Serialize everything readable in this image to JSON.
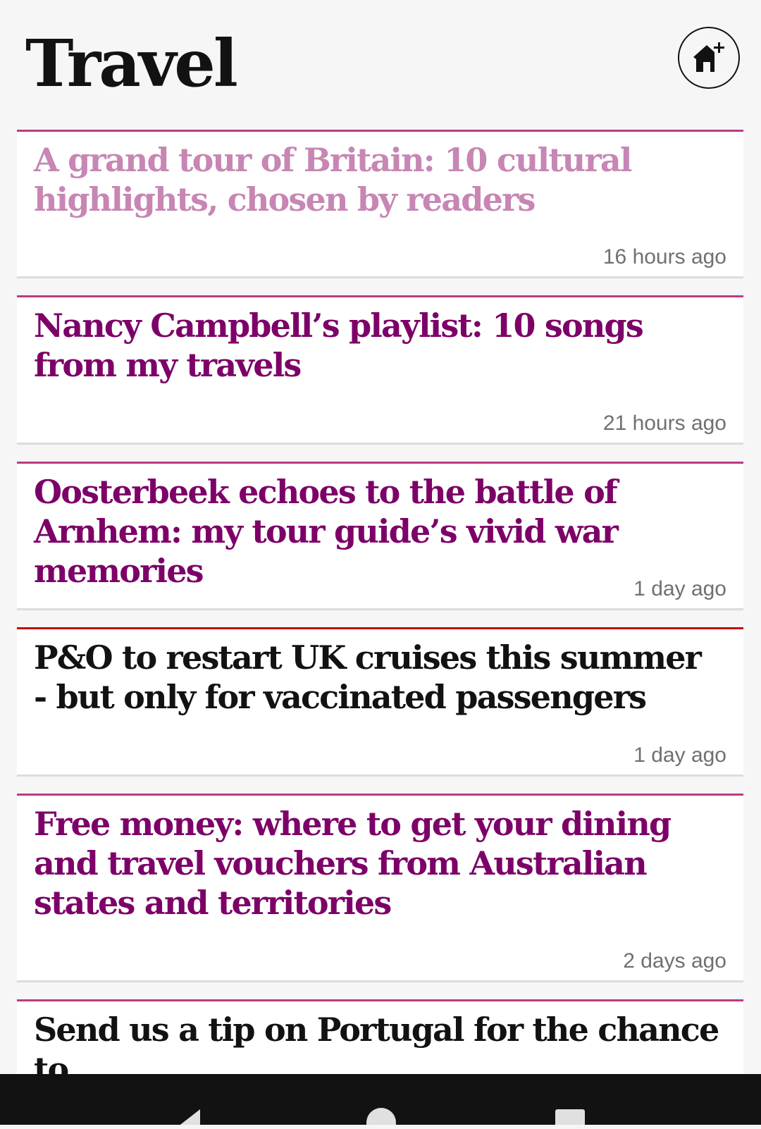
{
  "header": {
    "title": "Travel",
    "home_button_icon": "home-add-icon"
  },
  "colors": {
    "background": "#f6f6f6",
    "lifestyle_accent": "#bb3b80",
    "lifestyle_headline": "#7d0068",
    "lifestyle_headline_read": "#c786b3",
    "news_accent": "#c70000",
    "news_headline": "#121212",
    "timestamp": "#707070"
  },
  "articles": [
    {
      "headline": "A grand tour of Britain: 10 cultural highlights, chosen by readers",
      "time": "16 hours ago",
      "pillar": "lifestyle",
      "read": true
    },
    {
      "headline": "Nancy Campbell’s playlist: 10 songs from my travels",
      "time": "21 hours ago",
      "pillar": "lifestyle",
      "read": false
    },
    {
      "headline": "Oosterbeek echoes to the battle of Arnhem: my tour guide’s vivid war memories",
      "time": "1 day ago",
      "pillar": "lifestyle",
      "read": false
    },
    {
      "headline": "P&O to restart UK cruises this summer - but only for vaccinated passengers",
      "time": "1 day ago",
      "pillar": "news",
      "read": false
    },
    {
      "headline": "Free money: where to get your dining and travel vouchers from Australian states and territories",
      "time": "2 days ago",
      "pillar": "lifestyle",
      "read": false
    },
    {
      "headline": "Send us a tip on Portugal for the chance to",
      "time": "",
      "pillar": "lifestyle",
      "read": false
    }
  ],
  "nav": {
    "back_icon": "back-icon",
    "home_icon": "home-icon",
    "recents_icon": "recents-icon"
  }
}
